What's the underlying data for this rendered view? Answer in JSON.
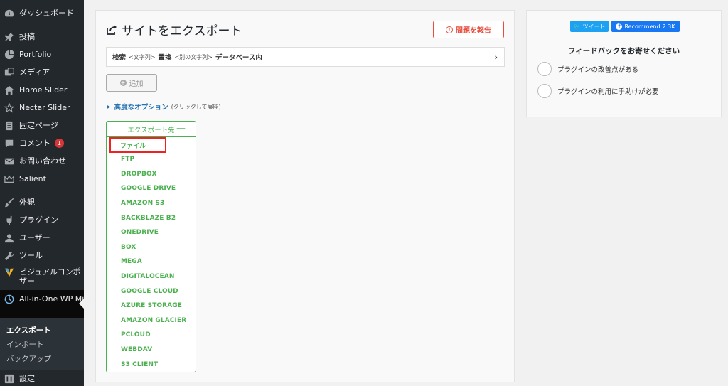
{
  "sidebar": {
    "items": [
      {
        "label": "ダッシュボード",
        "icon": "dashboard-icon"
      },
      {
        "label": "投稿",
        "icon": "pin-icon"
      },
      {
        "label": "Portfolio",
        "icon": "portfolio-icon"
      },
      {
        "label": "メディア",
        "icon": "media-icon"
      },
      {
        "label": "Home Slider",
        "icon": "home-icon"
      },
      {
        "label": "Nectar Slider",
        "icon": "star-icon"
      },
      {
        "label": "固定ページ",
        "icon": "page-icon"
      },
      {
        "label": "コメント",
        "icon": "comment-icon",
        "badge": "1"
      },
      {
        "label": "お問い合わせ",
        "icon": "mail-icon"
      },
      {
        "label": "Salient",
        "icon": "crown-icon"
      },
      {
        "label": "外観",
        "icon": "brush-icon"
      },
      {
        "label": "プラグイン",
        "icon": "plugin-icon"
      },
      {
        "label": "ユーザー",
        "icon": "user-icon"
      },
      {
        "label": "ツール",
        "icon": "wrench-icon"
      },
      {
        "label": "ビジュアルコンポザー",
        "icon": "vc-icon"
      },
      {
        "label": "All-in-One WP Migration",
        "icon": "migration-icon"
      },
      {
        "label": "設定",
        "icon": "settings-icon"
      }
    ],
    "submenu": [
      "エクスポート",
      "インポート",
      "バックアップ"
    ]
  },
  "main": {
    "title": "サイトをエクスポート",
    "report_label": "問題を報告",
    "search": {
      "find_label": "検索",
      "find_placeholder": "<文字列>",
      "replace_label": "置換",
      "replace_placeholder": "<別の文字列>",
      "suffix": "データベース内"
    },
    "add_label": "追加",
    "advanced_link": "高度なオプション",
    "advanced_hint": "(クリックして展開)",
    "export_to": "エクスポート先",
    "export_options": [
      "ファイル",
      "FTP",
      "DROPBOX",
      "GOOGLE DRIVE",
      "AMAZON S3",
      "BACKBLAZE B2",
      "ONEDRIVE",
      "BOX",
      "MEGA",
      "DIGITALOCEAN",
      "GOOGLE CLOUD",
      "AZURE STORAGE",
      "AMAZON GLACIER",
      "PCLOUD",
      "WEBDAV",
      "S3 CLIENT"
    ]
  },
  "right": {
    "tweet_label": "ツイート",
    "fb_label": "Recommend",
    "fb_count": "2.3K",
    "feedback_title": "フィードバックをお寄せください",
    "options": [
      "プラグインの改善点がある",
      "プラグインの利用に手助けが必要"
    ]
  },
  "colors": {
    "sidebar_bg": "#23282d",
    "export_green": "#4cb050",
    "report_red": "#e74c3c",
    "highlight_red": "#e22222",
    "link_blue": "#2271b1"
  }
}
